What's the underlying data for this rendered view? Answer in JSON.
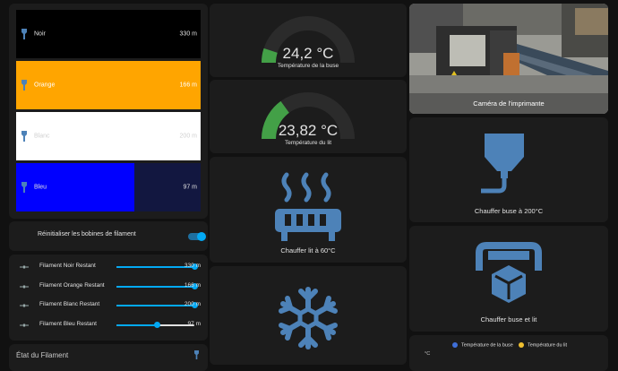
{
  "spools": [
    {
      "name": "Noir",
      "value": "330 m",
      "bg": "#000000",
      "fill": "#000000",
      "fill_fraction": 1.0,
      "text_color": "#e1e1e1"
    },
    {
      "name": "Orange",
      "value": "166 m",
      "bg": "#ffa500",
      "fill": "#ffa500",
      "fill_fraction": 1.0,
      "text_color": "#ffffff"
    },
    {
      "name": "Blanc",
      "value": "200 m",
      "bg": "#ffffff",
      "fill": "#ffffff",
      "fill_fraction": 1.0,
      "text_color": "#d0d0d0"
    },
    {
      "name": "Bleu",
      "value": "97 m",
      "bg": "#121740",
      "fill": "#0000ff",
      "fill_fraction": 0.64,
      "text_color": "#e1e1e1"
    }
  ],
  "reset": {
    "label": "Réinitialiser les bobines de filament",
    "state": "on"
  },
  "sliders": [
    {
      "label": "Filament Noir Restant",
      "value": "330 m",
      "fraction": 1.0
    },
    {
      "label": "Filament Orange Restant",
      "value": "166 m",
      "fraction": 1.0
    },
    {
      "label": "Filament Blanc Restant",
      "value": "200 m",
      "fraction": 1.0
    },
    {
      "label": "Filament Bleu Restant",
      "value": "97 m",
      "fraction": 0.52
    }
  ],
  "state_card": {
    "title": "État du Filament"
  },
  "gauges": [
    {
      "value": "24,2 °C",
      "label": "Température de la buse",
      "fraction": 0.1
    },
    {
      "value": "23,82 °C",
      "label": "Température du lit",
      "fraction": 0.3
    }
  ],
  "heat_bed_button": {
    "label": "Chauffer lit à 60°C"
  },
  "camera": {
    "label": "Caméra de l'imprimante"
  },
  "heat_nozzle_button": {
    "label": "Chauffer buse à 200°C"
  },
  "heat_both_button": {
    "label": "Chauffer buse et lit"
  },
  "history": {
    "legend": [
      {
        "label": "Température de la buse",
        "color": "#3f6fd8"
      },
      {
        "label": "Température du lit",
        "color": "#f0c030"
      }
    ],
    "unit": "°C"
  },
  "colors": {
    "accent": "#03a9f4",
    "icon": "#4d82b8",
    "gauge_fill": "#43a047",
    "gauge_track": "#2b2b2b"
  }
}
